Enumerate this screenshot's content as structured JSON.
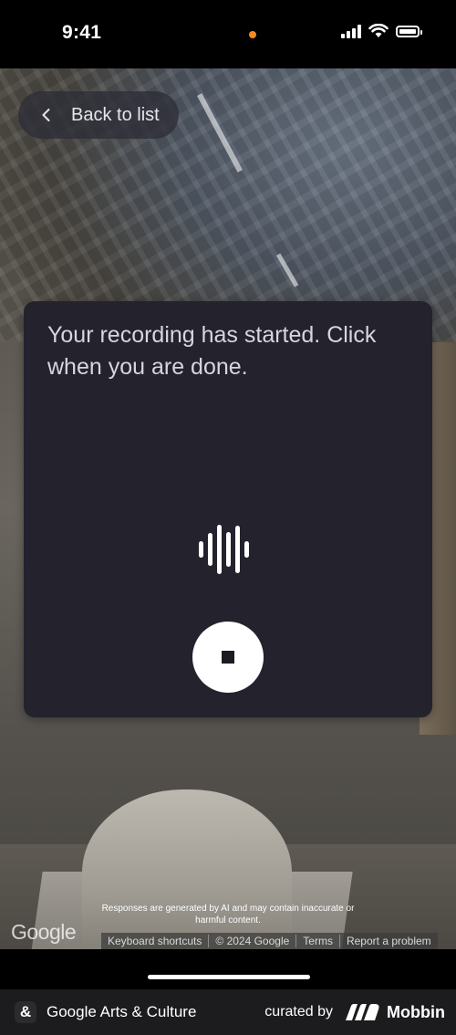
{
  "status_bar": {
    "time": "9:41"
  },
  "navigation": {
    "back_label": "Back to list"
  },
  "recording_panel": {
    "message": "Your recording has started. Click when you are done.",
    "waveform_icon": "audio-waveform-icon",
    "stop_icon": "stop-square-icon"
  },
  "footer": {
    "disclaimer": "Responses are generated by AI and may contain inaccurate or harmful content.",
    "map_brand": "Google",
    "links": [
      "Keyboard shortcuts",
      "© 2024 Google",
      "Terms",
      "Report a problem"
    ]
  },
  "bottom_bar": {
    "app_icon_glyph": "&",
    "app_name": "Google Arts & Culture",
    "curated_by": "curated by",
    "brand": "Mobbin"
  },
  "colors": {
    "panel_bg": "#24222d",
    "panel_text": "#d7d5dd",
    "status_dot": "#f08a24"
  }
}
